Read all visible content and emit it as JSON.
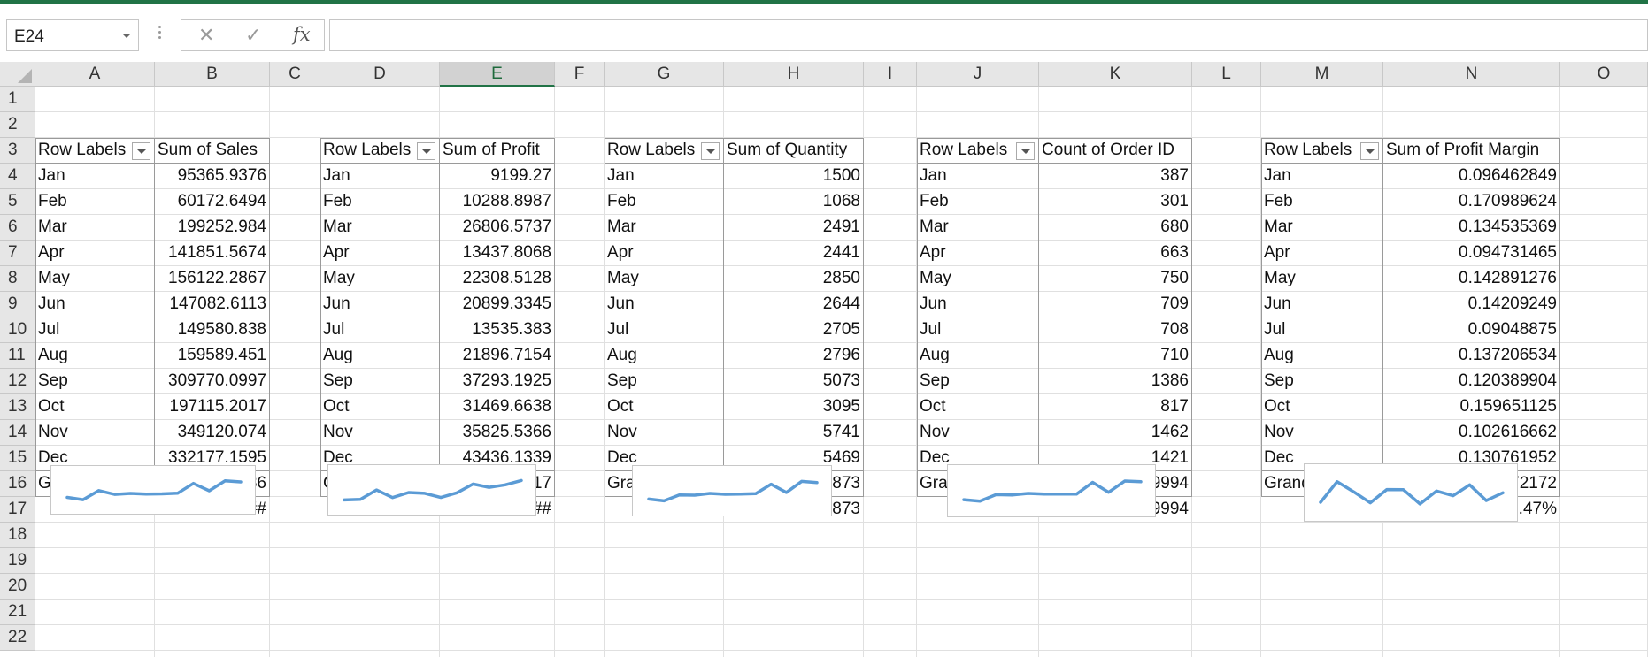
{
  "name_box": {
    "value": "E24"
  },
  "formula_bar": {
    "cancel_icon": "✕",
    "enter_icon": "✓",
    "fx_label": "fx",
    "value": ""
  },
  "columns": [
    "A",
    "B",
    "C",
    "D",
    "E",
    "F",
    "G",
    "H",
    "I",
    "J",
    "K",
    "L",
    "M",
    "N",
    "O"
  ],
  "selected_column": "E",
  "rows": [
    "1",
    "2",
    "3",
    "4",
    "5",
    "6",
    "7",
    "8",
    "9",
    "10",
    "11",
    "12",
    "13",
    "14",
    "15",
    "16",
    "17",
    "18",
    "19",
    "20",
    "21",
    "22"
  ],
  "months": [
    "Jan",
    "Feb",
    "Mar",
    "Apr",
    "May",
    "Jun",
    "Jul",
    "Aug",
    "Sep",
    "Oct",
    "Nov",
    "Dec"
  ],
  "pivots": [
    {
      "row_label": "Row Labels",
      "value_label": "Sum of Sales",
      "values": [
        "95365.9376",
        "60172.6494",
        "199252.984",
        "141851.5674",
        "156122.2867",
        "147082.6113",
        "149580.838",
        "159589.451",
        "309770.0997",
        "197115.2017",
        "349120.074",
        "332177.1595"
      ],
      "grand_total_label": "Grand Total",
      "grand_total": "2297200.86",
      "below_total": "##########"
    },
    {
      "row_label": "Row Labels",
      "value_label": "Sum of Profit",
      "values": [
        "9199.27",
        "10288.8987",
        "26806.5737",
        "13437.8068",
        "22308.5128",
        "20899.3345",
        "13535.383",
        "21896.7154",
        "37293.1925",
        "31469.6638",
        "35825.5366",
        "43436.1339"
      ],
      "grand_total_label": "Grand Total",
      "grand_total": "286397.0217",
      "below_total": "##########"
    },
    {
      "row_label": "Row Labels",
      "value_label": "Sum of Quantity",
      "values": [
        "1500",
        "1068",
        "2491",
        "2441",
        "2850",
        "2644",
        "2705",
        "2796",
        "5073",
        "3095",
        "5741",
        "5469"
      ],
      "grand_total_label": "Grand Total",
      "grand_total": "37873",
      "below_total": "# 37873"
    },
    {
      "row_label": "Row Labels",
      "value_label": "Count of Order ID",
      "values": [
        "387",
        "301",
        "680",
        "663",
        "750",
        "709",
        "708",
        "710",
        "1386",
        "817",
        "1462",
        "1421"
      ],
      "grand_total_label": "Grand Total",
      "grand_total": "9994",
      "below_total": "# 9994"
    },
    {
      "row_label": "Row Labels",
      "value_label": "Sum of Profit Margin",
      "values": [
        "0.096462849",
        "0.170989624",
        "0.134535369",
        "0.094731465",
        "0.142891276",
        "0.14209249",
        "0.09048875",
        "0.137206534",
        "0.120389904",
        "0.159651125",
        "0.102616662",
        "0.130761952"
      ],
      "grand_total_label": "Grand Total",
      "grand_total": "0.124672172",
      "below_total": "12.47%"
    }
  ],
  "sparkline_color": "#5b9bd5"
}
